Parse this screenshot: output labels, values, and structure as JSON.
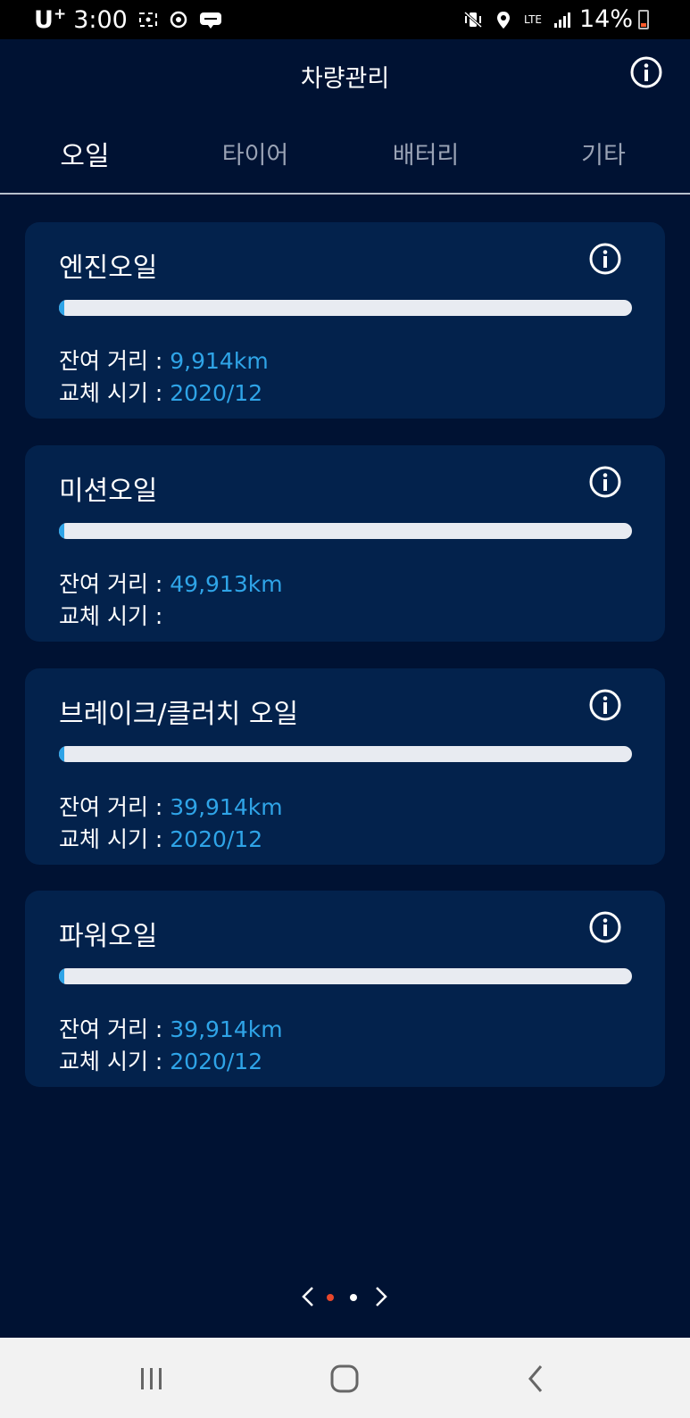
{
  "status_bar": {
    "carrier": "U",
    "carrier_sup": "+",
    "time": "3:00",
    "battery": "14%",
    "network": "LTE"
  },
  "header": {
    "title": "차량관리"
  },
  "tabs": [
    {
      "label": "오일",
      "active": true
    },
    {
      "label": "타이어",
      "active": false
    },
    {
      "label": "배터리",
      "active": false
    },
    {
      "label": "기타",
      "active": false
    }
  ],
  "cards": [
    {
      "title": "엔진오일",
      "progress": 0.01,
      "distance_label": "잔여 거리 : ",
      "distance": "9,914km",
      "date_label": "교체 시기 : ",
      "date": "2020/12"
    },
    {
      "title": "미션오일",
      "progress": 0.01,
      "distance_label": "잔여 거리 : ",
      "distance": "49,913km",
      "date_label": "교체 시기 : ",
      "date": ""
    },
    {
      "title": "브레이크/클러치 오일",
      "progress": 0.01,
      "distance_label": "잔여 거리 : ",
      "distance": "39,914km",
      "date_label": "교체 시기 : ",
      "date": "2020/12"
    },
    {
      "title": "파워오일",
      "progress": 0.01,
      "distance_label": "잔여 거리 : ",
      "distance": "39,914km",
      "date_label": "교체 시기 : ",
      "date": "2020/12"
    }
  ],
  "pager": {
    "current": 1,
    "total": 2,
    "active_color": "#e8472b",
    "inactive_color": "#ffffff"
  },
  "colors": {
    "background": "#001233",
    "card": "#03224c",
    "accent": "#2fa4e7",
    "bar_track": "#e8ebf1"
  }
}
